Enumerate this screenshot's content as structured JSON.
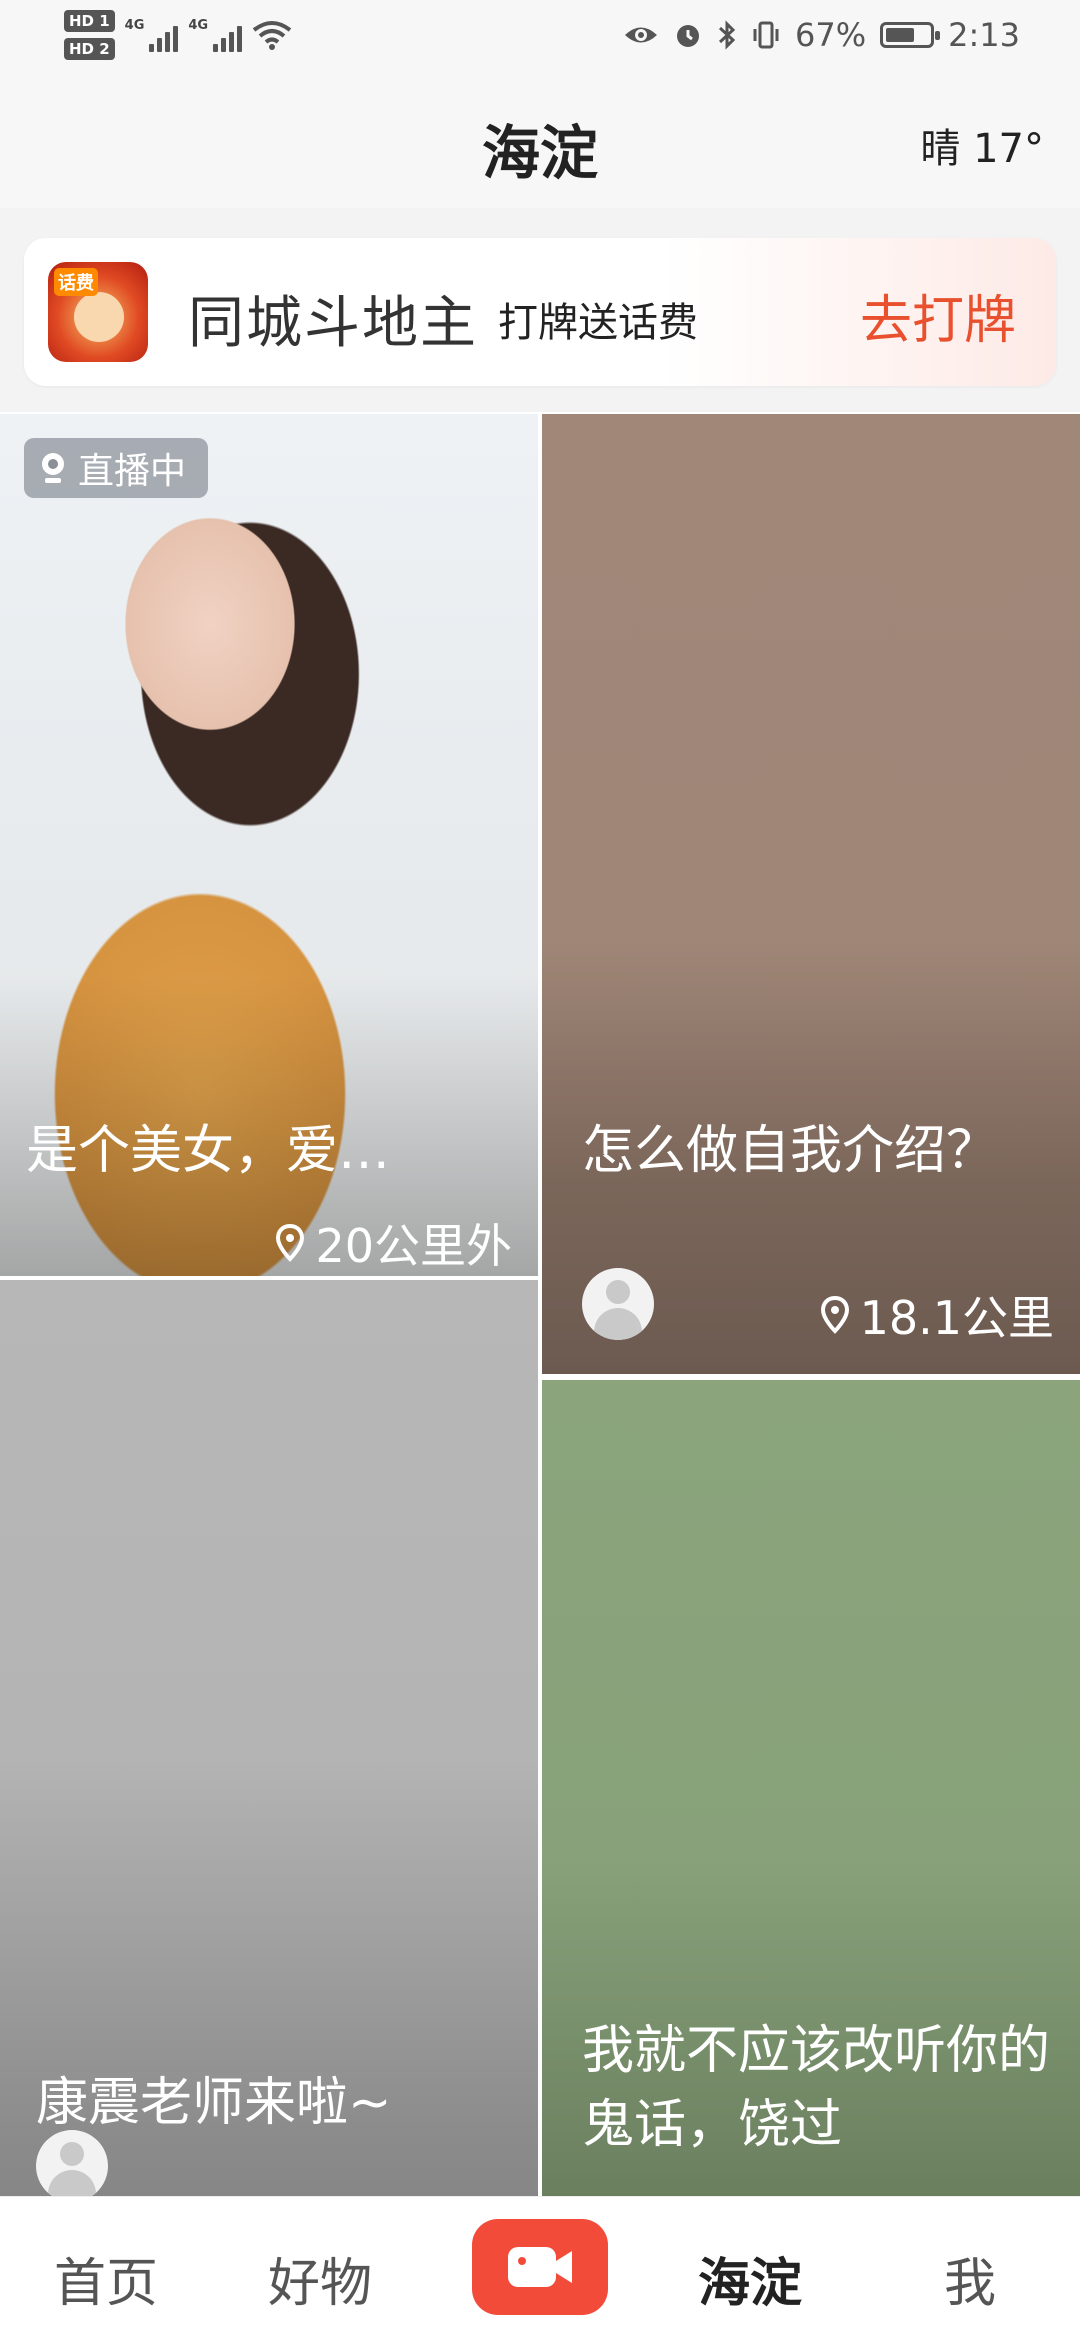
{
  "status_bar": {
    "hd1": "HD 1",
    "hd2": "HD 2",
    "net1": "4G",
    "net2": "4G",
    "battery": "67%",
    "time": "2:13",
    "battery_level": 0.67,
    "icons": [
      "eye-icon",
      "alarm-icon",
      "bluetooth-icon",
      "vibrate-icon",
      "battery-icon"
    ]
  },
  "header": {
    "city": "海淀",
    "weather": "晴 17°"
  },
  "banner": {
    "title": "同城斗地主",
    "subtitle": "打牌送话费",
    "cta": "去打牌",
    "icon_tag": "话费",
    "cta_color": "#e8502e"
  },
  "feed": [
    {
      "title": "是个美女，爱…",
      "badge": "直播中",
      "distance": "20公里外"
    },
    {
      "title": "怎么做自我介绍？",
      "distance": "18.1公里"
    },
    {
      "title": "康震老师来啦~"
    },
    {
      "title": "我就不应该改听你的鬼话，饶过"
    }
  ],
  "bottom_nav": {
    "items": [
      "首页",
      "好物",
      "海淀",
      "我"
    ],
    "active": "海淀",
    "record_color": "#f24b3a"
  }
}
